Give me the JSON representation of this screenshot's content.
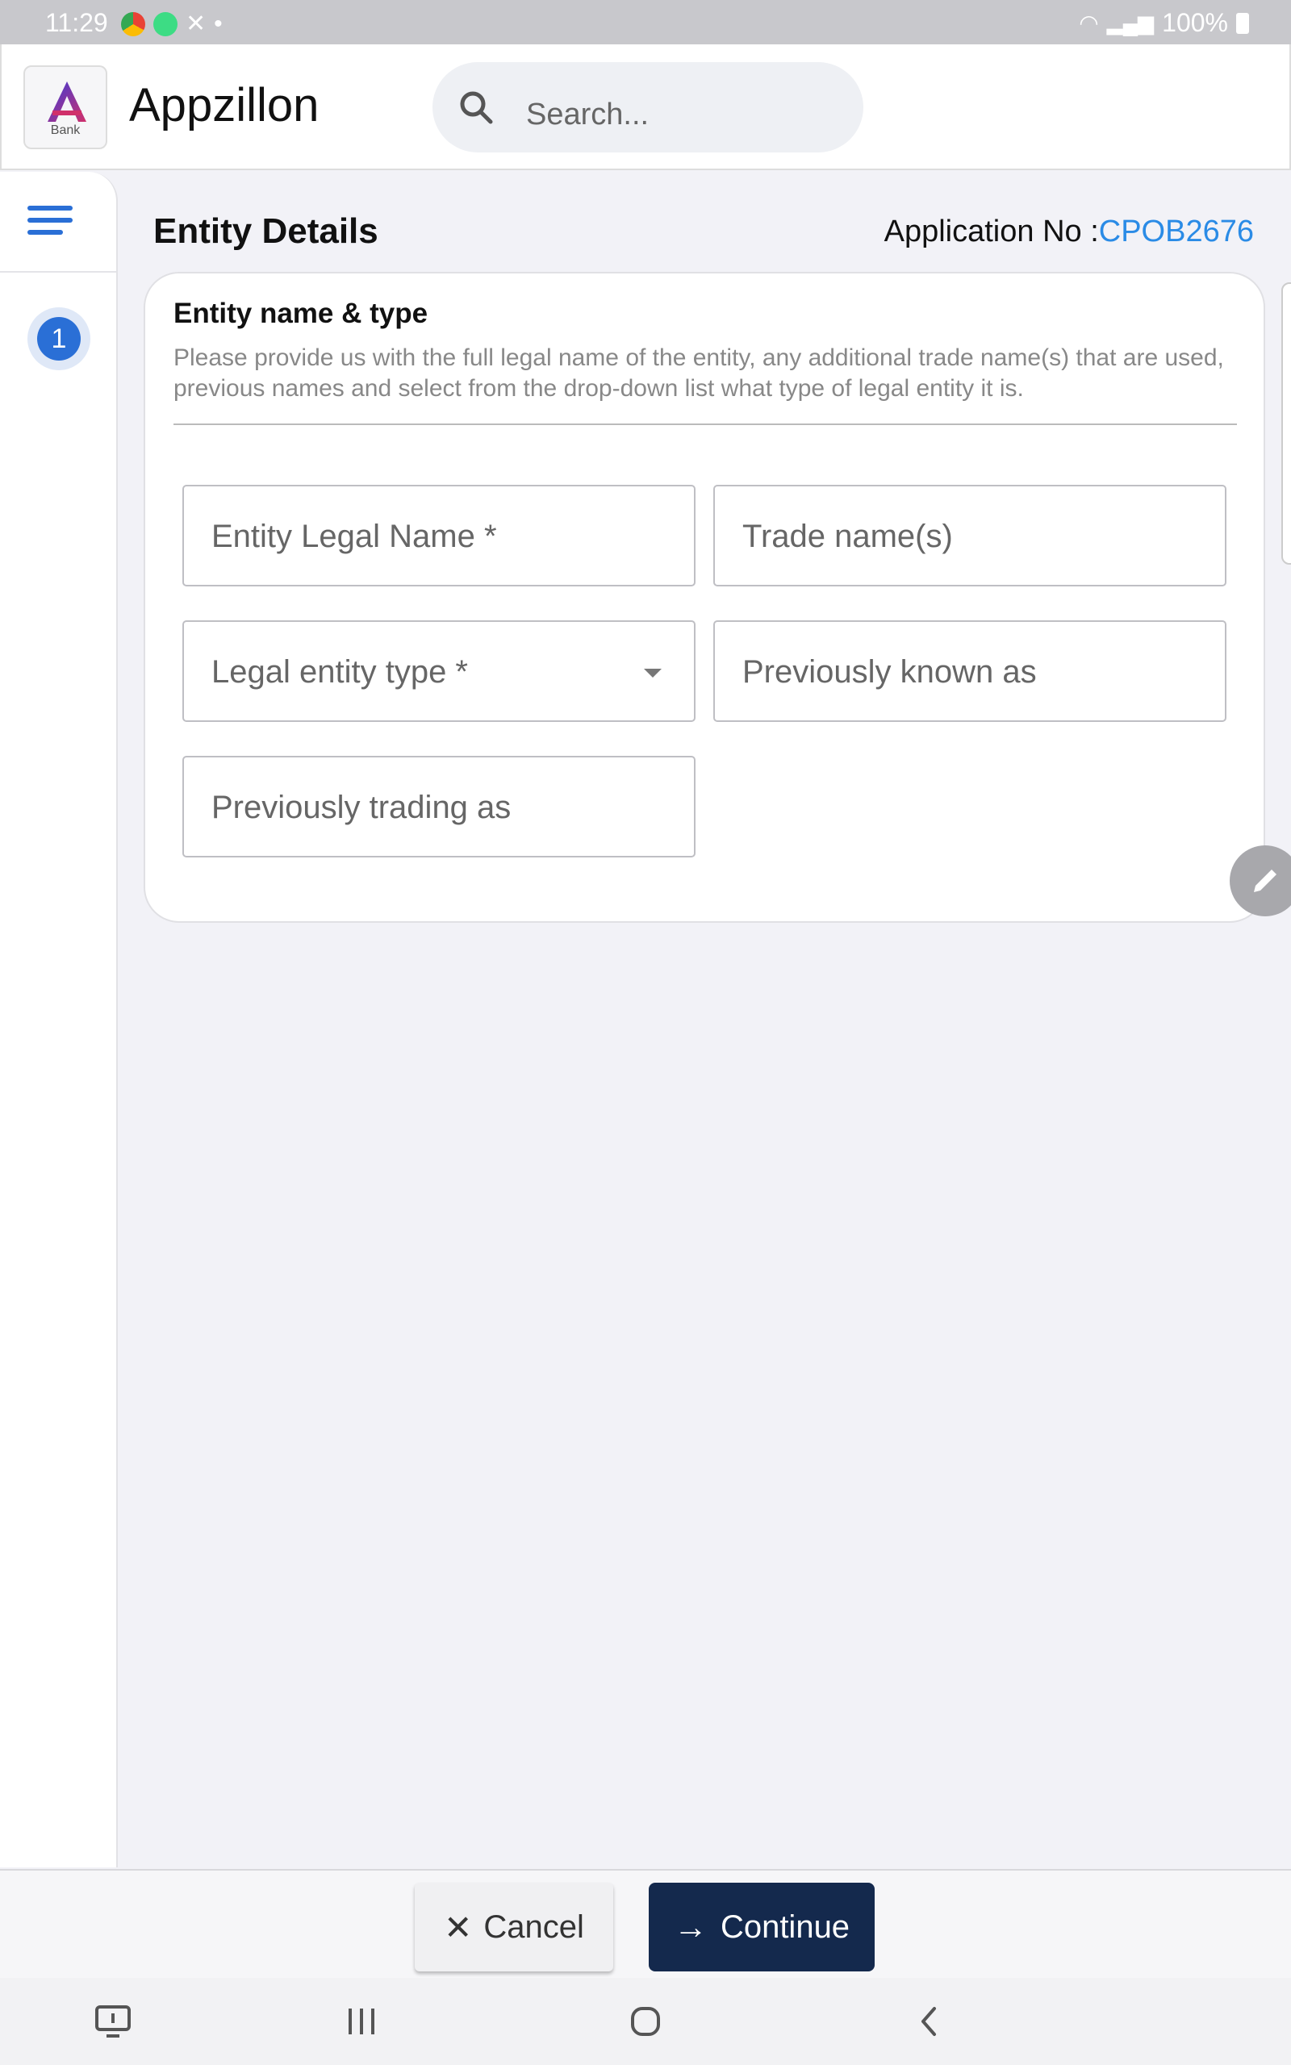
{
  "status_bar": {
    "time": "11:29",
    "battery": "100%"
  },
  "header": {
    "app_name": "Appzillon",
    "logo_caption": "Bank",
    "search_placeholder": "Search..."
  },
  "rail": {
    "step_number": "1"
  },
  "page": {
    "title": "Entity Details",
    "application_label": "Application No :",
    "application_number": "CPOB2676"
  },
  "card": {
    "title": "Entity name & type",
    "description": "Please provide us with the full legal name of the entity, any additional trade name(s) that are used, previous names and select from the drop-down list what type of legal entity it is.",
    "fields": {
      "entity_legal_name": "Entity Legal Name *",
      "trade_names": "Trade name(s)",
      "legal_entity_type": "Legal entity type *",
      "previously_known_as": "Previously known as",
      "previously_trading_as": "Previously trading as"
    }
  },
  "actions": {
    "cancel_label": "Cancel",
    "continue_label": "Continue"
  },
  "colors": {
    "primary_blue": "#2a6fd6",
    "link_blue": "#2a8be6",
    "continue_button": "#14294d"
  }
}
